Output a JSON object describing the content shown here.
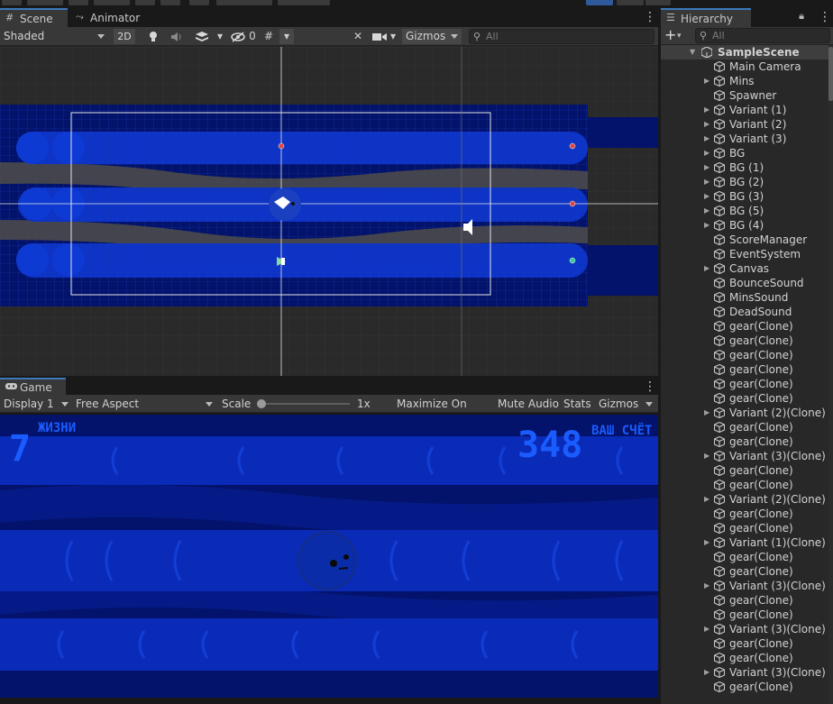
{
  "scene_panel": {
    "tabs": [
      {
        "label": "Scene",
        "icon": "grid-icon"
      },
      {
        "label": "Animator",
        "icon": "animator-icon"
      }
    ],
    "shading_mode": "Shaded",
    "mode_2d": "2D",
    "hidden_count": "0",
    "gizmos_label": "Gizmos",
    "search_placeholder": "All"
  },
  "game_panel": {
    "tab_label": "Game",
    "display": "Display 1",
    "aspect": "Free Aspect",
    "scale_label": "Scale",
    "scale_value": "1x",
    "maximize_label": "Maximize On Play",
    "mute_label": "Mute Audio",
    "stats_label": "Stats",
    "gizmos_label": "Gizmos",
    "hud": {
      "lives_value": "7",
      "lives_label": "ЖИЗНИ",
      "score_value": "348",
      "score_label": "ВАШ СЧЁТ"
    }
  },
  "hierarchy": {
    "tab_label": "Hierarchy",
    "search_placeholder": "All",
    "scene_name": "SampleScene",
    "items": [
      {
        "label": "Main Camera",
        "expandable": false
      },
      {
        "label": "Mins",
        "expandable": true
      },
      {
        "label": "Spawner",
        "expandable": false
      },
      {
        "label": "Variant (1)",
        "expandable": true
      },
      {
        "label": "Variant (2)",
        "expandable": true
      },
      {
        "label": "Variant (3)",
        "expandable": true
      },
      {
        "label": "BG",
        "expandable": true
      },
      {
        "label": "BG (1)",
        "expandable": true
      },
      {
        "label": "BG (2)",
        "expandable": true
      },
      {
        "label": "BG (3)",
        "expandable": true
      },
      {
        "label": "BG (5)",
        "expandable": true
      },
      {
        "label": "BG (4)",
        "expandable": true
      },
      {
        "label": "ScoreManager",
        "expandable": false
      },
      {
        "label": "EventSystem",
        "expandable": false
      },
      {
        "label": "Canvas",
        "expandable": true
      },
      {
        "label": "BounceSound",
        "expandable": false
      },
      {
        "label": "MinsSound",
        "expandable": false
      },
      {
        "label": "DeadSound",
        "expandable": false
      },
      {
        "label": "gear(Clone)",
        "expandable": false
      },
      {
        "label": "gear(Clone)",
        "expandable": false
      },
      {
        "label": "gear(Clone)",
        "expandable": false
      },
      {
        "label": "gear(Clone)",
        "expandable": false
      },
      {
        "label": "gear(Clone)",
        "expandable": false
      },
      {
        "label": "gear(Clone)",
        "expandable": false
      },
      {
        "label": "Variant (2)(Clone)",
        "expandable": true
      },
      {
        "label": "gear(Clone)",
        "expandable": false
      },
      {
        "label": "gear(Clone)",
        "expandable": false
      },
      {
        "label": "Variant (3)(Clone)",
        "expandable": true
      },
      {
        "label": "gear(Clone)",
        "expandable": false
      },
      {
        "label": "gear(Clone)",
        "expandable": false
      },
      {
        "label": "Variant (2)(Clone)",
        "expandable": true
      },
      {
        "label": "gear(Clone)",
        "expandable": false
      },
      {
        "label": "gear(Clone)",
        "expandable": false
      },
      {
        "label": "Variant (1)(Clone)",
        "expandable": true
      },
      {
        "label": "gear(Clone)",
        "expandable": false
      },
      {
        "label": "gear(Clone)",
        "expandable": false
      },
      {
        "label": "Variant (3)(Clone)",
        "expandable": true
      },
      {
        "label": "gear(Clone)",
        "expandable": false
      },
      {
        "label": "gear(Clone)",
        "expandable": false
      },
      {
        "label": "Variant (3)(Clone)",
        "expandable": true
      },
      {
        "label": "gear(Clone)",
        "expandable": false
      },
      {
        "label": "gear(Clone)",
        "expandable": false
      },
      {
        "label": "Variant (3)(Clone)",
        "expandable": true
      },
      {
        "label": "gear(Clone)",
        "expandable": false
      }
    ]
  },
  "colors": {
    "accent_tab": "#3a79bb",
    "game_blue": "#0d33c7",
    "game_dark": "#03126a",
    "hud_text": "#1a5cff"
  }
}
